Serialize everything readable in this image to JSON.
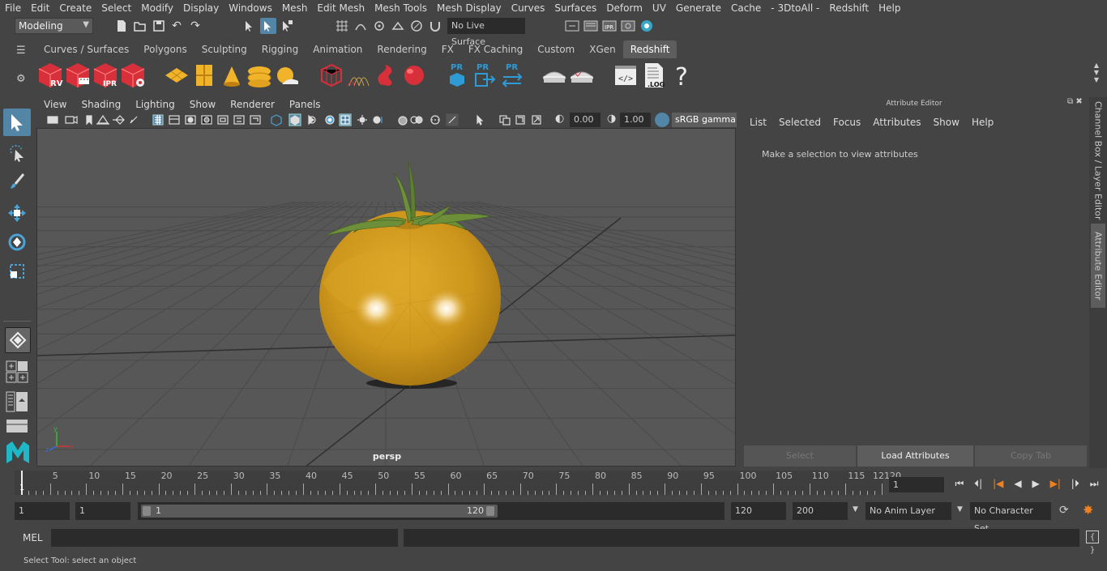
{
  "menubar": [
    "File",
    "Edit",
    "Create",
    "Select",
    "Modify",
    "Display",
    "Windows",
    "Mesh",
    "Edit Mesh",
    "Mesh Tools",
    "Mesh Display",
    "Curves",
    "Surfaces",
    "Deform",
    "UV",
    "Generate",
    "Cache",
    "- 3DtoAll -",
    "Redshift",
    "Help"
  ],
  "status": {
    "mode": "Modeling",
    "live_surface": "No Live Surface"
  },
  "shelf": {
    "tabs": [
      "Curves / Surfaces",
      "Polygons",
      "Sculpting",
      "Rigging",
      "Animation",
      "Rendering",
      "FX",
      "FX Caching",
      "Custom",
      "XGen",
      "Redshift"
    ],
    "active_tab": "Redshift",
    "icon_labels": {
      "rv": "RV",
      "ipr": "IPR",
      "pr1": "PR",
      "pr2": "PR",
      "pr3": "PR",
      "log": ".LOG",
      "help": "?"
    }
  },
  "viewport": {
    "menu": [
      "View",
      "Shading",
      "Lighting",
      "Show",
      "Renderer",
      "Panels"
    ],
    "exposure": "0.00",
    "gamma": "1.00",
    "color_space": "sRGB gamma",
    "camera_label": "persp"
  },
  "attribute_editor": {
    "title": "Attribute Editor",
    "menu": [
      "List",
      "Selected",
      "Focus",
      "Attributes",
      "Show",
      "Help"
    ],
    "message": "Make a selection to view attributes",
    "buttons": [
      "Select",
      "Load Attributes",
      "Copy Tab"
    ]
  },
  "side_tabs": [
    "Channel Box / Layer Editor",
    "Attribute Editor"
  ],
  "timeline": {
    "ticks": [
      5,
      10,
      15,
      20,
      25,
      30,
      35,
      40,
      45,
      50,
      55,
      60,
      65,
      70,
      75,
      80,
      85,
      90,
      95,
      100,
      105,
      110,
      115,
      120
    ],
    "current_frame": "1",
    "start_marker": "1",
    "end_marker": "12"
  },
  "range": {
    "start": "1",
    "playback_start": "1",
    "slider_start": "1",
    "slider_end": "120",
    "playback_end": "120",
    "end": "200",
    "anim_layer": "No Anim Layer",
    "char_set": "No Character Set"
  },
  "command_line": {
    "lang": "MEL"
  },
  "help_line": "Select Tool: select an object",
  "colors": {
    "accent": "#5285a6",
    "shelf_red": "#d8303a",
    "tomato": "#d49a1c",
    "shelf_yellow": "#f0b42a",
    "shelf_blue": "#2e9bd6"
  }
}
